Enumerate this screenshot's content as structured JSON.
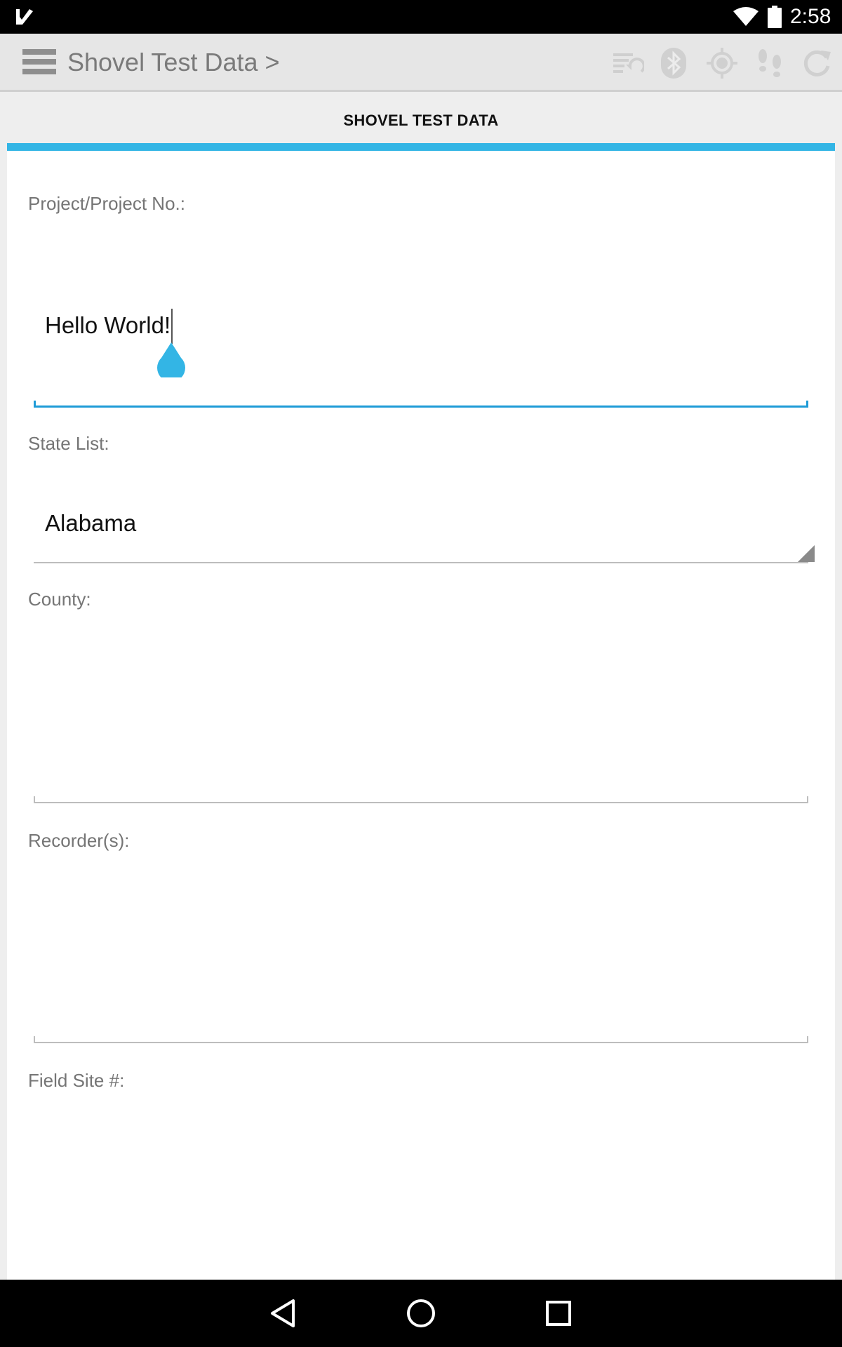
{
  "status_bar": {
    "time": "2:58",
    "icons": [
      "app-notification-icon",
      "wifi-icon",
      "battery-icon"
    ]
  },
  "app_bar": {
    "title": "Shovel Test Data >",
    "toolbar_icons": [
      "sync-list-icon",
      "bluetooth-icon",
      "gps-icon",
      "footsteps-icon",
      "refresh-icon"
    ]
  },
  "tab": {
    "label": "SHOVEL TEST DATA",
    "accent_color": "#33b5e5"
  },
  "form": {
    "project": {
      "label": "Project/Project No.:",
      "value": "Hello World!"
    },
    "state": {
      "label": "State List:",
      "value": "Alabama"
    },
    "county": {
      "label": "County:",
      "value": ""
    },
    "recorders": {
      "label": "Recorder(s):",
      "value": ""
    },
    "field_site": {
      "label": "Field Site #:",
      "value": ""
    }
  },
  "nav_bar": {
    "icons": [
      "back-icon",
      "home-icon",
      "recents-icon"
    ]
  }
}
